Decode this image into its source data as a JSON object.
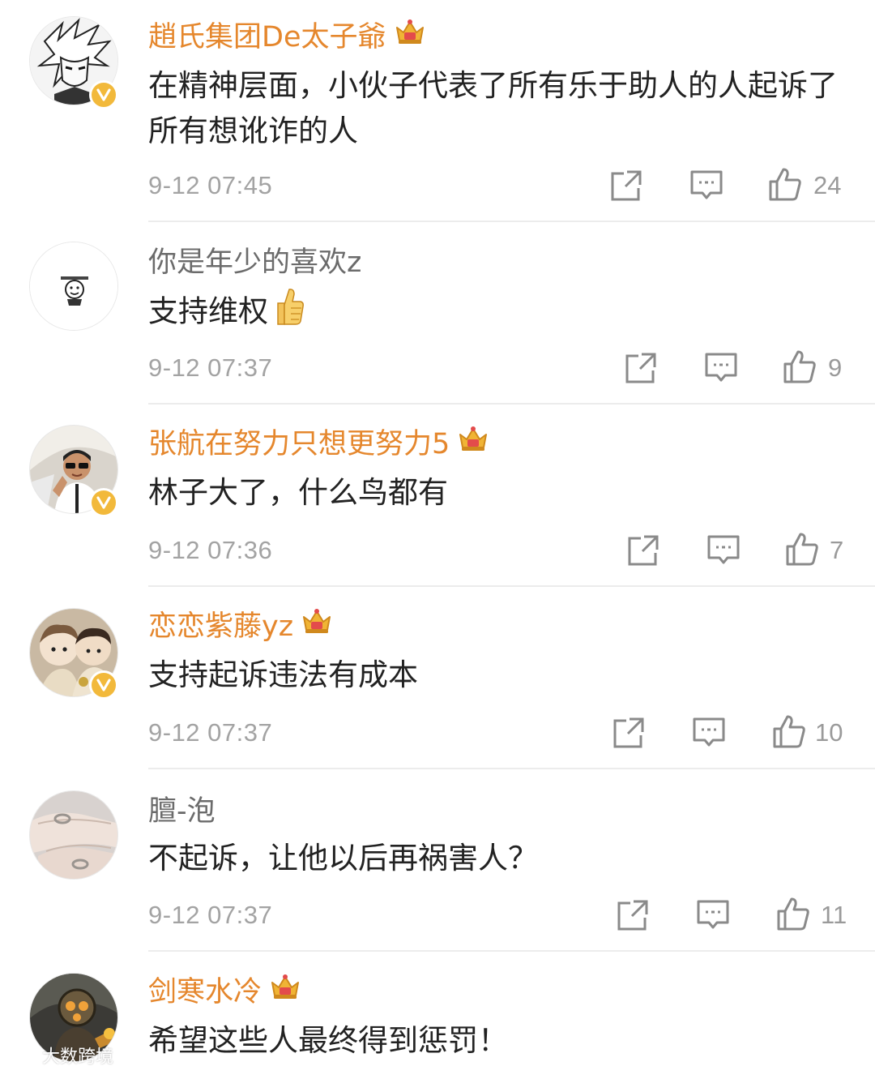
{
  "colors": {
    "vip_name": "#e5872d",
    "plain_name": "#6b6b6b",
    "badge": "#f2b93b",
    "meta": "#a3a3a3"
  },
  "comments": [
    {
      "username": "趙氏集团De太子爺",
      "vip": true,
      "verified": true,
      "text": "在精神层面，小伙子代表了所有乐于助人的人起诉了所有想讹诈的人",
      "time": "9-12 07:45",
      "likes": "24"
    },
    {
      "username": "你是年少的喜欢z",
      "vip": false,
      "verified": false,
      "text": "支持维权",
      "emoji": "thumbs-up-emoji",
      "time": "9-12 07:37",
      "likes": "9"
    },
    {
      "username": "张航在努力只想更努力5",
      "vip": true,
      "verified": true,
      "text": "林子大了，什么鸟都有",
      "time": "9-12 07:36",
      "likes": "7"
    },
    {
      "username": "恋恋紫藤yz",
      "vip": true,
      "verified": true,
      "text": "支持起诉违法有成本",
      "time": "9-12 07:37",
      "likes": "10"
    },
    {
      "username": "膻-泡",
      "vip": false,
      "verified": false,
      "text": "不起诉，让他以后再祸害人？",
      "time": "9-12 07:37",
      "likes": "11"
    },
    {
      "username": "剑寒水冷",
      "vip": true,
      "verified": false,
      "text": "希望这些人最终得到惩罚！",
      "time": "",
      "likes": ""
    }
  ],
  "icons": {
    "repost": "share-icon",
    "comment": "comment-icon",
    "like": "thumbs-up-icon",
    "vip": "crown-icon",
    "verified": "verified-v-icon"
  },
  "watermark": "大数跨境"
}
